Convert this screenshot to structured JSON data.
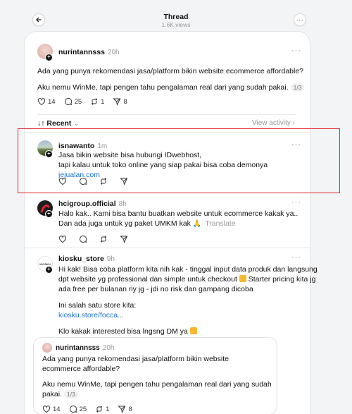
{
  "header": {
    "title": "Thread",
    "views": "1.6K views",
    "back_icon": "arrow-left-icon",
    "more_icon": "more-dots-icon"
  },
  "original_post": {
    "username": "nurintannsss",
    "time": "20h",
    "line1": "Ada yang punya rekomendasi jasa/platform bikin website ecommerce affordable?",
    "line2": "Aku nemu WinMe, tapi pengen tahu pengalaman real dari yang sudah pakai.",
    "page_badge": "1/3",
    "likes": "14",
    "replies": "25",
    "reposts": "1",
    "shares": "8"
  },
  "sort": {
    "label": "Recent",
    "view_activity": "View activity"
  },
  "replies": [
    {
      "username": "isnawanto",
      "time": "1m",
      "line1": "Jasa bikin website bisa hubungi IDwebhost,",
      "line2_prefix": "tapi kalau untuk toko online yang siap pakai bisa coba demonya ",
      "link": "jejualan.com"
    },
    {
      "username": "hcigroup.official",
      "time": "8h",
      "line1": "Halo kak.. Kami bisa bantu buatkan website untuk ecommerce kakak ya..",
      "line2": "Dan ada juga untuk yg paket UMKM kak",
      "translate": "Translate"
    },
    {
      "username": "kiosku_store",
      "time": "9h",
      "avatar_text": "KIOSKU",
      "para1_l1": "Hi kak! Bisa coba platform kita nih kak - tinggal input data produk dan langsung",
      "para1_l2": "dpt website yg professional dan simple untuk checkout",
      "para1_l2b": " Starter pricing kita jg",
      "para1_l3": "ada free per bulanan ny jg - jdi no risk dan gampang dicoba",
      "para2_l1": "Ini salah satu store kita:",
      "para2_link": "kiosku.store/focca...",
      "para3": "Klo kakak interested bisa lngsng DM ya"
    }
  ],
  "quoted": {
    "username": "nurintannsss",
    "time": "20h",
    "l1": "Ada yang punya rekomendasi jasa/platform bikin website",
    "l2": "ecommerce affordable?",
    "l3": "Aku nemu WinMe, tapi pengen tahu pengalaman real dari yang sudah",
    "l4": "pakai.",
    "page_badge": "1/3",
    "likes": "14",
    "replies": "25",
    "reposts": "1",
    "shares": "8"
  }
}
